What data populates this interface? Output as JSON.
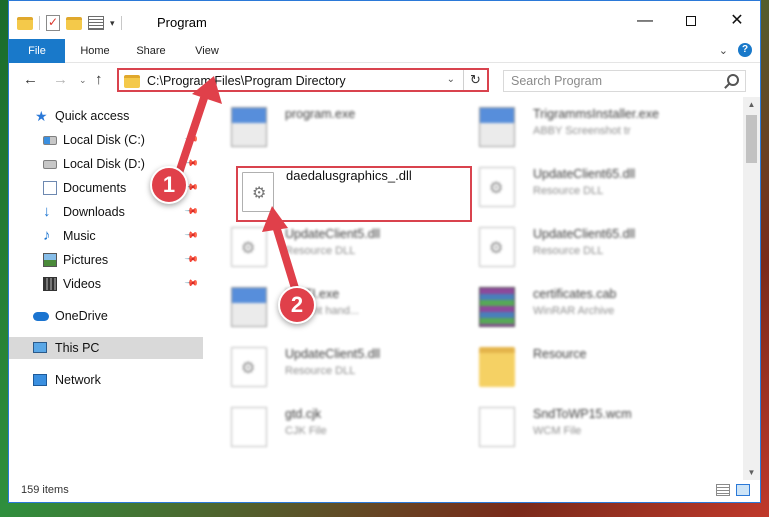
{
  "window": {
    "title": "Program",
    "minimize_glyph": "—",
    "close_glyph": "✕"
  },
  "ribbon": {
    "tabs": [
      {
        "label": "File"
      },
      {
        "label": "Home"
      },
      {
        "label": "Share"
      },
      {
        "label": "View"
      }
    ],
    "collapse_glyph": "⌄",
    "help_glyph": "?"
  },
  "address_bar": {
    "path": "C:\\Program Files\\Program Directory",
    "search_placeholder": "Search Program",
    "back_glyph": "←",
    "forward_glyph": "→",
    "up_glyph": "↑",
    "drop_glyph": "⌄",
    "refresh_glyph": "↻"
  },
  "sidebar": {
    "items": [
      {
        "label": "Quick access"
      },
      {
        "label": "Local Disk (C:)"
      },
      {
        "label": "Local Disk (D:)"
      },
      {
        "label": "Documents"
      },
      {
        "label": "Downloads"
      },
      {
        "label": "Music"
      },
      {
        "label": "Pictures"
      },
      {
        "label": "Videos"
      },
      {
        "label": "OneDrive"
      },
      {
        "label": "This PC"
      },
      {
        "label": "Network"
      }
    ],
    "pin_glyph": "📌"
  },
  "files": {
    "highlighted": {
      "name": "daedalusgraphics_.dll"
    },
    "items": [
      {
        "name": "program.exe",
        "type": ""
      },
      {
        "name": "TrigrammsInstaller.exe",
        "type": "ABBY Screenshot tr"
      },
      {
        "name": "UpdateClient65.dll",
        "type": "Resource DLL"
      },
      {
        "name": "UpdateClient5.dll",
        "type": "Resource DLL"
      },
      {
        "name": "UpdateClient65.dll",
        "type": "Resource DLL"
      },
      {
        "name": "ify5TI.exe",
        "type": "ili event hand..."
      },
      {
        "name": "certificates.cab",
        "type": "WinRAR Archive"
      },
      {
        "name": "UpdateClient5.dll",
        "type": "Resource DLL"
      },
      {
        "name": "Resource",
        "type": ""
      },
      {
        "name": "gtd.cjk",
        "type": "CJK File"
      },
      {
        "name": "SndToWP15.wcm",
        "type": "WCM File"
      }
    ]
  },
  "status": {
    "item_count": "159 items"
  },
  "annotations": {
    "step1": "1",
    "step2": "2",
    "color": "#e0404a"
  }
}
